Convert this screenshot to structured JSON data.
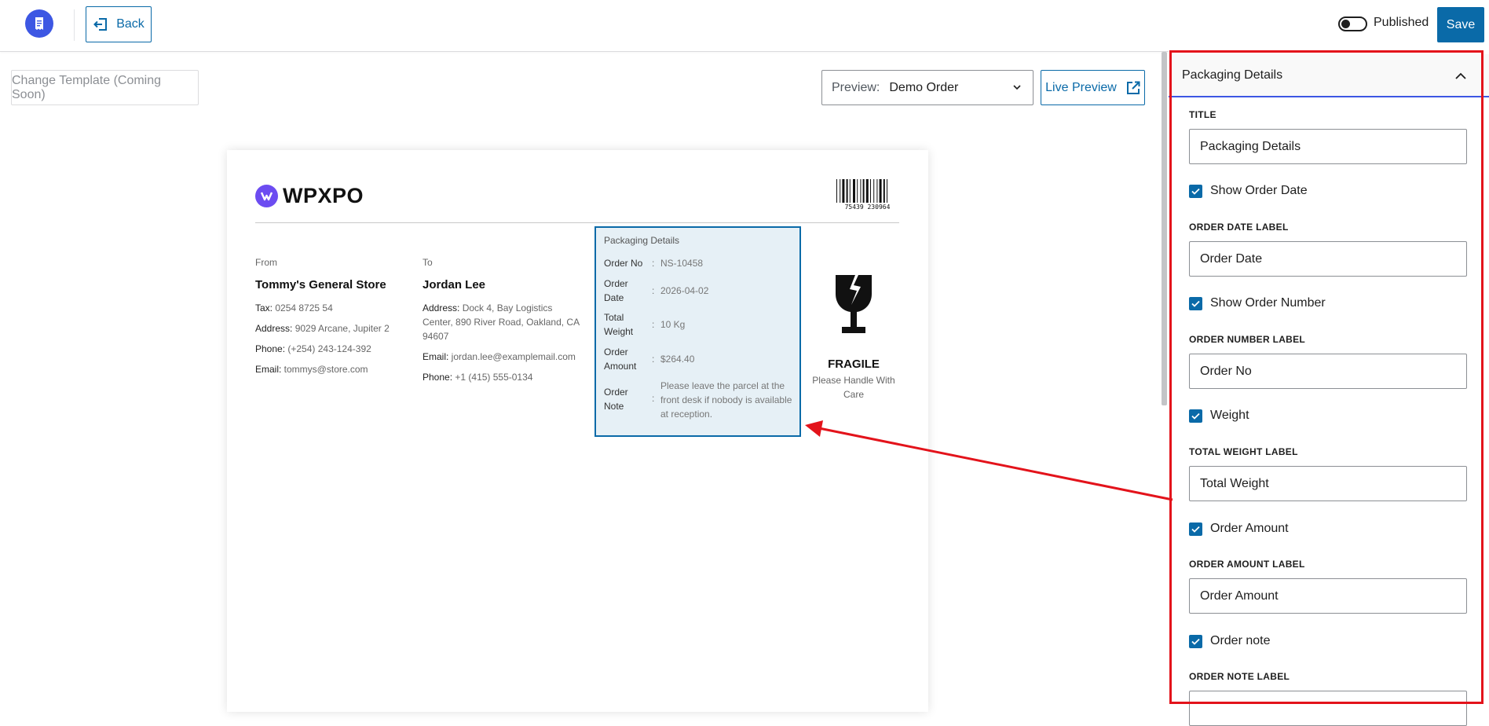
{
  "topbar": {
    "app_icon": "receipt-icon",
    "back_label": "Back",
    "published_label": "Published",
    "published_on": false,
    "save_label": "Save"
  },
  "toolbar": {
    "change_template_label": "Change Template (Coming Soon)",
    "preview_label": "Preview:",
    "preview_value": "Demo Order",
    "live_preview_label": "Live Preview"
  },
  "invoice": {
    "brand_name": "WPXPO",
    "barcode_number": "75439 230964",
    "from": {
      "heading": "From",
      "name": "Tommy's General Store",
      "lines": [
        {
          "key": "Tax:",
          "value": " 0254 8725 54"
        },
        {
          "key": "Address:",
          "value": " 9029 Arcane, Jupiter 2"
        },
        {
          "key": "Phone:",
          "value": " (+254) 243-124-392"
        },
        {
          "key": "Email:",
          "value": " tommys@store.com"
        }
      ]
    },
    "to": {
      "heading": "To",
      "name": "Jordan Lee",
      "lines": [
        {
          "key": "Address:",
          "value": " Dock 4, Bay Logistics Center, 890 River Road, Oakland, CA 94607"
        },
        {
          "key": "Email:",
          "value": " jordan.lee@examplemail.com"
        },
        {
          "key": "Phone:",
          "value": " +1 (415) 555-0134"
        }
      ]
    },
    "packaging": {
      "title": "Packaging Details",
      "rows": [
        {
          "key": "Order No",
          "sep": ":",
          "value": "NS-10458"
        },
        {
          "key": "Order Date",
          "sep": ":",
          "value": "2026-04-02"
        },
        {
          "key": "Total Weight",
          "sep": ":",
          "value": "10 Kg"
        },
        {
          "key": "Order Amount",
          "sep": ":",
          "value": "$264.40"
        },
        {
          "key": "Order Note",
          "sep": ":",
          "value": "Please leave the parcel at the front desk if nobody is available at reception."
        }
      ]
    },
    "fragile": {
      "title": "FRAGILE",
      "subtitle": "Please Handle With Care",
      "icon": "fragile-glass-icon"
    }
  },
  "panel": {
    "section_title": "Packaging Details",
    "fields": {
      "title_label": "TITLE",
      "title_value": "Packaging Details",
      "show_order_date": "Show Order Date",
      "order_date_label": "ORDER DATE LABEL",
      "order_date_value": "Order Date",
      "show_order_number": "Show Order Number",
      "order_number_label": "ORDER NUMBER LABEL",
      "order_number_value": "Order No",
      "weight": "Weight",
      "total_weight_label": "TOTAL WEIGHT LABEL",
      "total_weight_value": "Total Weight",
      "order_amount": "Order Amount",
      "order_amount_label": "ORDER AMOUNT LABEL",
      "order_amount_value": "Order Amount",
      "order_note": "Order note",
      "order_note_label": "ORDER NOTE LABEL"
    }
  },
  "colors": {
    "accent": "#0a6aa8",
    "annotation": "#e3131b",
    "highlight_bg": "#e6f0f6"
  }
}
